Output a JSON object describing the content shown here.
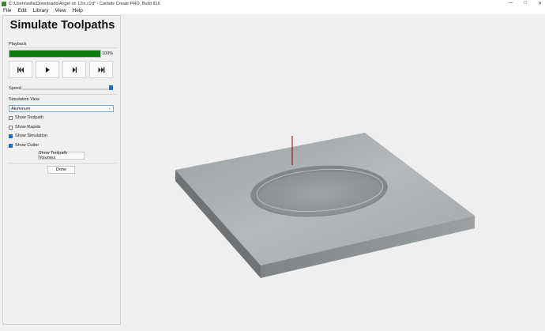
{
  "window": {
    "title": "C:\\Users\\willa\\Downloads\\Angel on 12in.c2d* - Carbide Create PRO, Build 816",
    "controls": [
      "—",
      "□",
      "✕"
    ]
  },
  "menu": [
    "File",
    "Edit",
    "Library",
    "View",
    "Help"
  ],
  "panel": {
    "title": "Simulate Toolpaths",
    "playback_label": "Playback",
    "progress": {
      "value": 100,
      "text": "100%"
    },
    "controls": [
      "rewind",
      "play",
      "step-forward",
      "fast-forward"
    ],
    "speed_label": "Speed",
    "speed_level": 0.96,
    "simulation_view_label": "Simulation View",
    "material": "Aluminum",
    "options": [
      {
        "label": "Show Toolpath",
        "checked": false
      },
      {
        "label": "Show Rapids",
        "checked": false
      },
      {
        "label": "Show Simulation",
        "checked": true
      },
      {
        "label": "Show Cutter",
        "checked": true
      }
    ],
    "show_volumes_button": "Show Toolpath Volumes",
    "done_button": "Done"
  },
  "colors": {
    "progress_fill": "#0f7b0f",
    "accent": "#1f6fc6",
    "cutter": "#8b0000"
  }
}
